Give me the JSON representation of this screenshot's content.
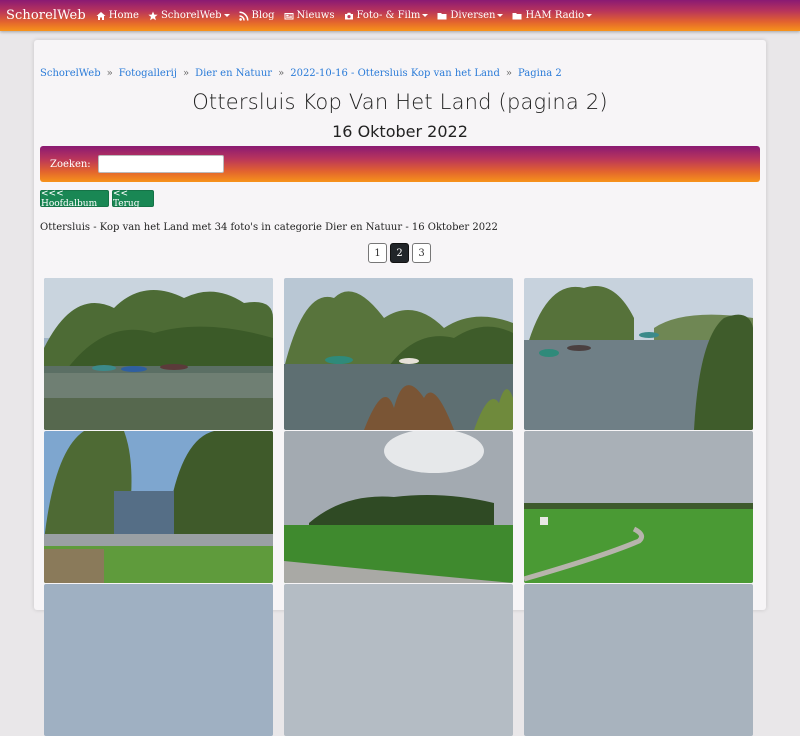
{
  "navbar": {
    "brand": "SchorelWeb",
    "items": [
      {
        "label": "Home",
        "icon": "home-icon",
        "dropdown": false
      },
      {
        "label": "SchorelWeb",
        "icon": "star-icon",
        "dropdown": true
      },
      {
        "label": "Blog",
        "icon": "rss-icon",
        "dropdown": false
      },
      {
        "label": "Nieuws",
        "icon": "newspaper-icon",
        "dropdown": false
      },
      {
        "label": "Foto- & Film",
        "icon": "camera-icon",
        "dropdown": true
      },
      {
        "label": "Diversen",
        "icon": "folder-icon",
        "dropdown": true
      },
      {
        "label": "HAM Radio",
        "icon": "folder-icon",
        "dropdown": true
      }
    ]
  },
  "breadcrumb": [
    "SchorelWeb",
    "Fotogallerij",
    "Dier en Natuur",
    "2022-10-16 - Ottersluis Kop van het Land",
    "Pagina 2"
  ],
  "page": {
    "title": "Ottersluis Kop Van Het Land (pagina 2)",
    "subtitle": "16 Oktober 2022",
    "description": "Ottersluis - Kop van het Land met 34 foto's in categorie Dier en Natuur - 16 Oktober 2022"
  },
  "search": {
    "label": "Zoeken:",
    "value": ""
  },
  "buttons": {
    "main_album": "<<< Hoofdalbum",
    "back": "<< Terug"
  },
  "pagination": {
    "pages": [
      "1",
      "2",
      "3"
    ],
    "current": "2"
  },
  "colors": {
    "gradient_start": "#8a1a73",
    "gradient_end": "#f7931a",
    "link": "#2a7bd8",
    "button": "#198754"
  }
}
